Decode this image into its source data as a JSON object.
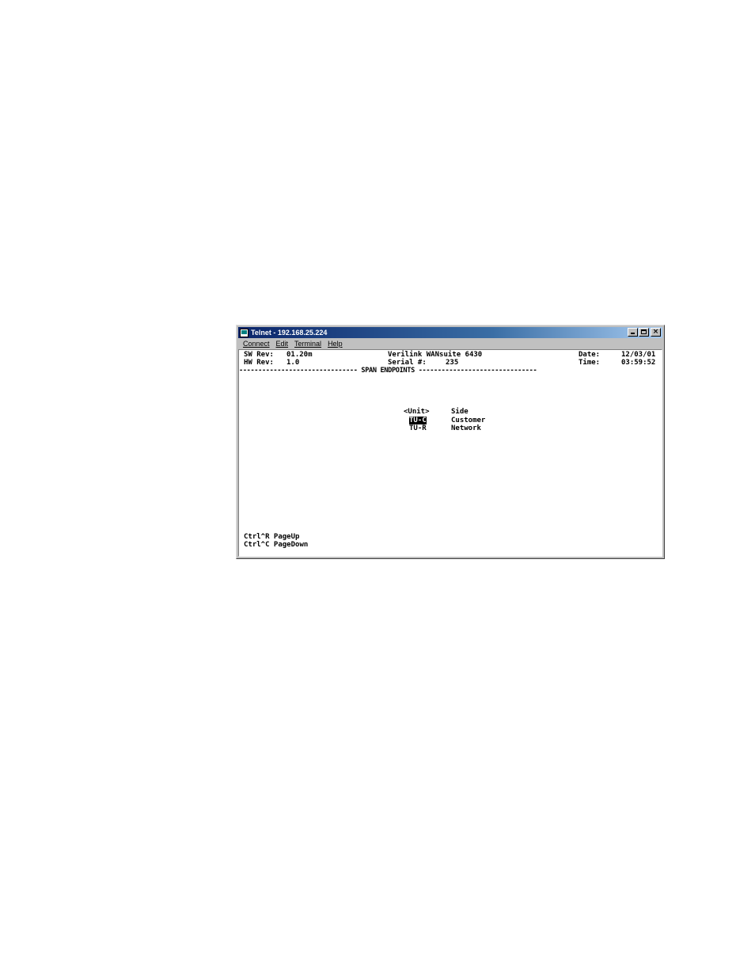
{
  "window": {
    "title": "Telnet - 192.168.25.224"
  },
  "menu": [
    {
      "label": "Connect"
    },
    {
      "label": "Edit"
    },
    {
      "label": "Terminal"
    },
    {
      "label": "Help"
    }
  ],
  "header": {
    "sw_rev_label": "SW Rev:",
    "sw_rev_value": "01.20m",
    "hw_rev_label": "HW Rev:",
    "hw_rev_value": "1.0",
    "product": "Verilink WANsuite 6430",
    "serial_label": "Serial #:",
    "serial_value": "235",
    "date_label": "Date:",
    "date_value": "12/03/01",
    "time_label": "Time:",
    "time_value": "03:59:52",
    "section_line": "------------------------------- SPAN ENDPOINTS -------------------------------"
  },
  "table": {
    "col_unit": "<Unit>",
    "col_side": "Side",
    "rows": [
      {
        "unit": "TU-C",
        "side": "Customer",
        "selected": true
      },
      {
        "unit": "TU-R",
        "side": "Network",
        "selected": false
      }
    ]
  },
  "footer": {
    "line1": "Ctrl^R PageUp",
    "line2": "Ctrl^C PageDown"
  }
}
